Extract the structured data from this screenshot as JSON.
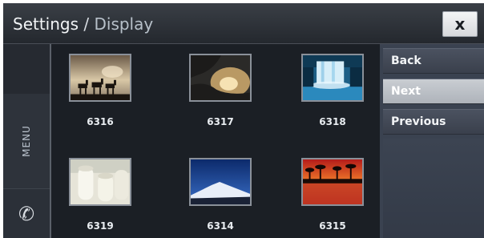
{
  "header": {
    "title": "Settings",
    "separator": " / ",
    "subtitle": "Display",
    "close_label": "x"
  },
  "sidebar": {
    "menu_label": "MENU",
    "phone_icon": "phone-icon",
    "phone_glyph": "✆"
  },
  "gallery": {
    "items": [
      {
        "caption": "6316",
        "image": "horses-silhouette"
      },
      {
        "caption": "6317",
        "image": "sunburst-clouds"
      },
      {
        "caption": "6318",
        "image": "waterfall"
      },
      {
        "caption": "6319",
        "image": "white-candles"
      },
      {
        "caption": "6314",
        "image": "snowy-mountain"
      },
      {
        "caption": "6315",
        "image": "sunset-palms"
      }
    ]
  },
  "right_menu": {
    "items": [
      {
        "label": "Back",
        "active": false
      },
      {
        "label": "Next",
        "active": true
      },
      {
        "label": "Previous",
        "active": false
      }
    ]
  },
  "colors": {
    "frame_bg": "#1b1f25",
    "menu_active": "#c9cdd2",
    "menu_bg": "#3a4250"
  }
}
